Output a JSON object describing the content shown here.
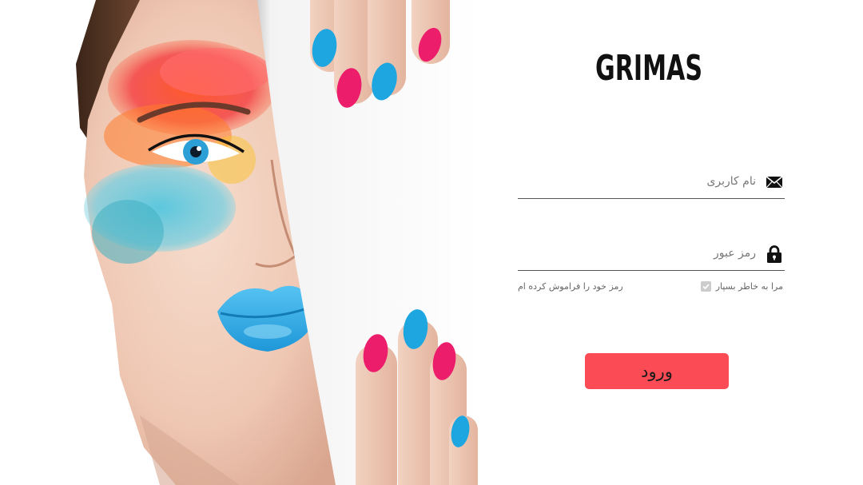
{
  "brand": {
    "logo_text": "GRIMAS"
  },
  "login_form": {
    "username_placeholder": "نام کاربری",
    "username_icon": "envelope-icon",
    "password_placeholder": "رمز عبور",
    "password_icon": "lock-icon",
    "remember_me_label": "مرا به خاطر بسپار",
    "remember_me_checked": true,
    "forgot_password_label": "رمز خود را فراموش کرده ام",
    "submit_label": "ورود"
  },
  "colors": {
    "accent": "#fb4c55",
    "underline": "#555555",
    "lip_blue": "#3aaee8",
    "nail_blue": "#1da6df",
    "nail_pink": "#ec1e6c"
  }
}
